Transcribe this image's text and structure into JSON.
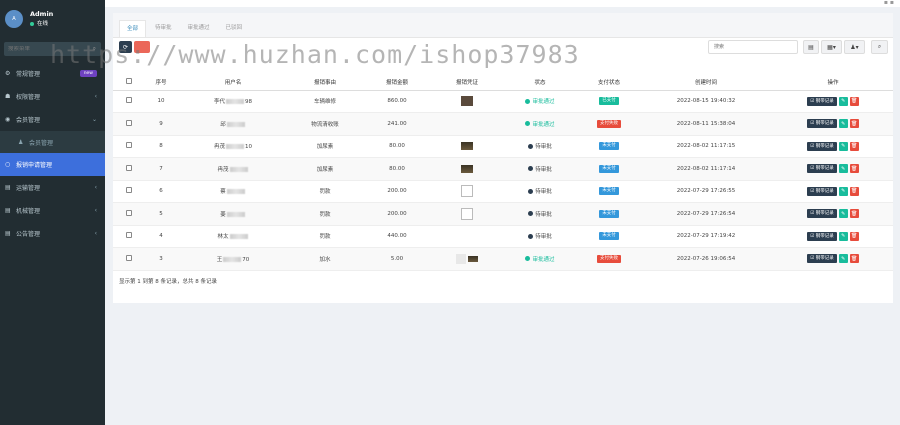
{
  "sidebar": {
    "user": {
      "name": "Admin",
      "status": "在线",
      "avatar_text": "A"
    },
    "search_placeholder": "搜索菜单",
    "items": [
      {
        "label": "常规管理",
        "icon": "gear-icon",
        "badge": "new"
      },
      {
        "label": "权限管理",
        "icon": "group-icon"
      },
      {
        "label": "会员管理",
        "icon": "user-circle-icon",
        "expanded": true
      },
      {
        "label": "会员管理",
        "icon": "user-icon",
        "sub": true
      },
      {
        "label": "报销申请管理",
        "icon": "circle-icon",
        "active": true
      },
      {
        "label": "运输管理",
        "icon": "list-icon"
      },
      {
        "label": "机械管理",
        "icon": "list-icon"
      },
      {
        "label": "公告管理",
        "icon": "list-icon"
      }
    ]
  },
  "tabs": [
    "全部",
    "待审批",
    "审批通过",
    "已驳回"
  ],
  "toolbar": {
    "search_placeholder": "搜索"
  },
  "table": {
    "headers": [
      "序号",
      "用户名",
      "报销事由",
      "报销金额",
      "报销凭证",
      "状态",
      "支付状态",
      "创建时间",
      "操作"
    ],
    "rows": [
      {
        "id": "10",
        "user_a": "李代",
        "user_b": "98",
        "reason": "车辆维修",
        "amount": "860.00",
        "voucher": "img",
        "status": "审批通过",
        "status_color": "green",
        "pay": "已支付",
        "pay_color": "green",
        "time": "2022-08-15 19:40:32"
      },
      {
        "id": "9",
        "user_a": "邱",
        "user_b": "",
        "reason": "物流清收账",
        "amount": "241.00",
        "voucher": "",
        "status": "审批通过",
        "status_color": "green",
        "pay": "支付失败",
        "pay_color": "red",
        "time": "2022-08-11 15:38:04"
      },
      {
        "id": "8",
        "user_a": "冉茂",
        "user_b": "10",
        "reason": "加尿素",
        "amount": "80.00",
        "voucher": "img-dark",
        "status": "待审批",
        "status_color": "grey",
        "pay": "未支付",
        "pay_color": "blue",
        "time": "2022-08-02 11:17:15"
      },
      {
        "id": "7",
        "user_a": "冉茂",
        "user_b": "",
        "reason": "加尿素",
        "amount": "80.00",
        "voucher": "img-dark",
        "status": "待审批",
        "status_color": "grey",
        "pay": "未支付",
        "pay_color": "blue",
        "time": "2022-08-02 11:17:14"
      },
      {
        "id": "6",
        "user_a": "蔡",
        "user_b": "",
        "reason": "罚款",
        "amount": "200.00",
        "voucher": "img-broken",
        "status": "待审批",
        "status_color": "grey",
        "pay": "未支付",
        "pay_color": "blue",
        "time": "2022-07-29 17:26:55"
      },
      {
        "id": "5",
        "user_a": "姜",
        "user_b": "",
        "reason": "罚款",
        "amount": "200.00",
        "voucher": "img-broken",
        "status": "待审批",
        "status_color": "grey",
        "pay": "未支付",
        "pay_color": "blue",
        "time": "2022-07-29 17:26:54"
      },
      {
        "id": "4",
        "user_a": "林太",
        "user_b": "",
        "reason": "罚款",
        "amount": "440.00",
        "voucher": "",
        "status": "待审批",
        "status_color": "grey",
        "pay": "未支付",
        "pay_color": "blue",
        "time": "2022-07-29 17:19:42"
      },
      {
        "id": "3",
        "user_a": "王",
        "user_b": "70",
        "reason": "加水",
        "amount": "5.00",
        "voucher": "img-pale",
        "status": "审批通过",
        "status_color": "green",
        "pay": "支付失败",
        "pay_color": "red",
        "time": "2022-07-26 19:06:54"
      }
    ],
    "op_log_label": "钢带记录",
    "footer": "显示第 1 到第 8 条记录，总共 8 条记录"
  },
  "watermark": "https://www.huzhan.com/ishop37983"
}
